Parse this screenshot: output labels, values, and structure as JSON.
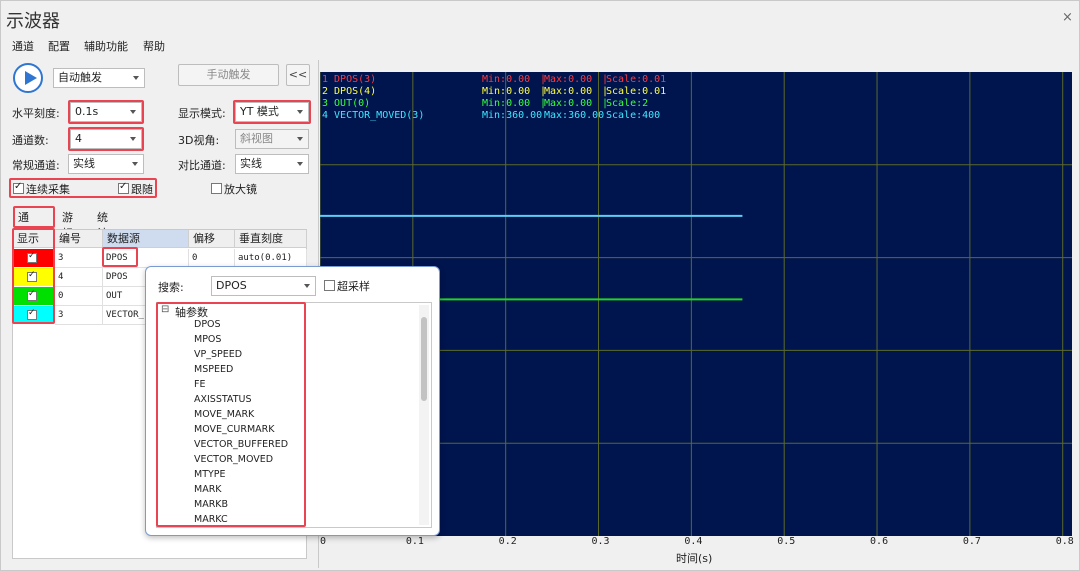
{
  "window": {
    "title": "示波器",
    "close": "×"
  },
  "menu": [
    "通道",
    "配置",
    "辅助功能",
    "帮助"
  ],
  "controls": {
    "trigger_mode": "自动触发",
    "manual_trigger": "手动触发",
    "collapse": "<<",
    "h_scale_label": "水平刻度:",
    "h_scale_value": "0.1s",
    "display_mode_label": "显示模式:",
    "display_mode_value": "YT 模式",
    "channels_label": "通道数:",
    "channels_value": "4",
    "view3d_label": "3D视角:",
    "view3d_value": "斜视图",
    "normal_channel_label": "常规通道:",
    "normal_channel_value": "实线",
    "compare_channel_label": "对比通道:",
    "compare_channel_value": "实线",
    "continuous_label": "连续采集",
    "follow_label": "跟随",
    "magnifier_label": "放大镜"
  },
  "tabs": [
    "通道号",
    "游标",
    "统计"
  ],
  "table": {
    "headers": [
      "显示",
      "编号",
      "数据源",
      "偏移",
      "垂直刻度"
    ],
    "rows": [
      {
        "color": "#ff0000",
        "id": "3",
        "source": "DPOS",
        "offset": "0",
        "scale": "auto(0.01)"
      },
      {
        "color": "#ffff00",
        "id": "4",
        "source": "DPOS",
        "offset": "",
        "scale": ""
      },
      {
        "color": "#00e000",
        "id": "0",
        "source": "OUT",
        "offset": "",
        "scale": ""
      },
      {
        "color": "#00ffff",
        "id": "3",
        "source": "VECTOR_",
        "offset": "",
        "scale": ""
      }
    ]
  },
  "legend": [
    {
      "color": "#ff3b3b",
      "name": "1 DPOS(3)",
      "min": "Min:0.00",
      "max": "Max:0.00",
      "scale": "Scale:0.01"
    },
    {
      "color": "#ffff40",
      "name": "2 DPOS(4)",
      "min": "Min:0.00",
      "max": "Max:0.00",
      "scale": "Scale:0.01"
    },
    {
      "color": "#3cff3c",
      "name": "3 OUT(0)",
      "min": "Min:0.00",
      "max": "Max:0.00",
      "scale": "Scale:2"
    },
    {
      "color": "#40e8ff",
      "name": "4 VECTOR_MOVED(3)",
      "min": "Min:360.00",
      "max": "Max:360.00",
      "scale": "Scale:400"
    }
  ],
  "chart_data": {
    "type": "line",
    "xlabel": "时间(s)",
    "x_ticks": [
      "0",
      "0.1",
      "0.2",
      "0.3",
      "0.4",
      "0.5",
      "0.6",
      "0.7",
      "0.8"
    ],
    "xlim": [
      0,
      0.81
    ],
    "grid": true,
    "series": [
      {
        "name": "4 VECTOR_MOVED(3)",
        "color": "#5ad0f5",
        "x": [
          0,
          0.455
        ],
        "level": 0.31
      },
      {
        "name": "3 OUT(0)",
        "color": "#22d322",
        "x": [
          0,
          0.455
        ],
        "level": 0.49
      }
    ]
  },
  "popup": {
    "search_label": "搜索:",
    "search_value": "DPOS",
    "oversample_label": "超采样",
    "tree_root": "轴参数",
    "tree_root_toggle": "⊟",
    "items": [
      "DPOS",
      "MPOS",
      "VP_SPEED",
      "MSPEED",
      "FE",
      "AXISSTATUS",
      "MOVE_MARK",
      "MOVE_CURMARK",
      "VECTOR_BUFFERED",
      "VECTOR_MOVED",
      "MTYPE",
      "MARK",
      "MARKB",
      "MARKC"
    ]
  }
}
